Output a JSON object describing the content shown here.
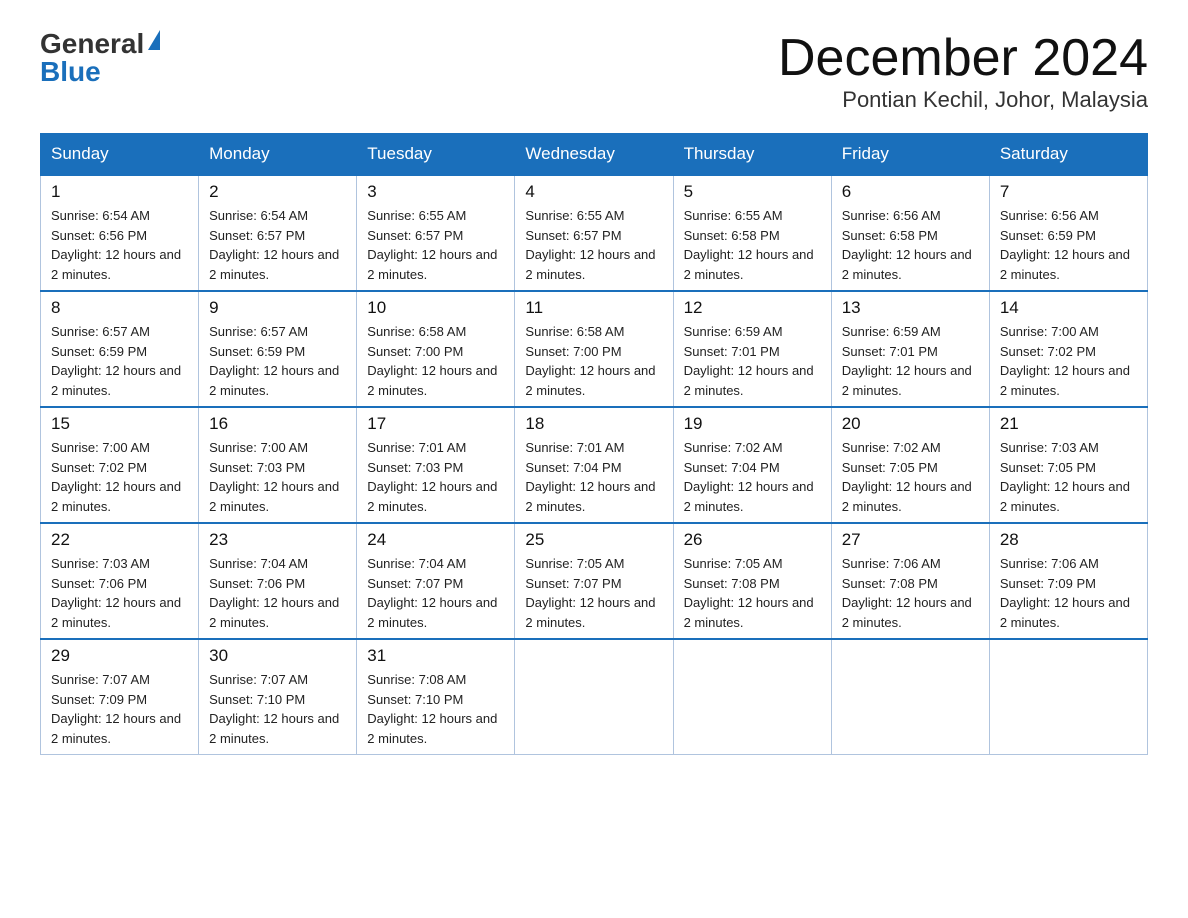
{
  "header": {
    "logo_general": "General",
    "logo_blue": "Blue",
    "title": "December 2024",
    "subtitle": "Pontian Kechil, Johor, Malaysia"
  },
  "weekdays": [
    "Sunday",
    "Monday",
    "Tuesday",
    "Wednesday",
    "Thursday",
    "Friday",
    "Saturday"
  ],
  "weeks": [
    [
      {
        "day": "1",
        "sunrise": "6:54 AM",
        "sunset": "6:56 PM",
        "daylight": "12 hours and 2 minutes."
      },
      {
        "day": "2",
        "sunrise": "6:54 AM",
        "sunset": "6:57 PM",
        "daylight": "12 hours and 2 minutes."
      },
      {
        "day": "3",
        "sunrise": "6:55 AM",
        "sunset": "6:57 PM",
        "daylight": "12 hours and 2 minutes."
      },
      {
        "day": "4",
        "sunrise": "6:55 AM",
        "sunset": "6:57 PM",
        "daylight": "12 hours and 2 minutes."
      },
      {
        "day": "5",
        "sunrise": "6:55 AM",
        "sunset": "6:58 PM",
        "daylight": "12 hours and 2 minutes."
      },
      {
        "day": "6",
        "sunrise": "6:56 AM",
        "sunset": "6:58 PM",
        "daylight": "12 hours and 2 minutes."
      },
      {
        "day": "7",
        "sunrise": "6:56 AM",
        "sunset": "6:59 PM",
        "daylight": "12 hours and 2 minutes."
      }
    ],
    [
      {
        "day": "8",
        "sunrise": "6:57 AM",
        "sunset": "6:59 PM",
        "daylight": "12 hours and 2 minutes."
      },
      {
        "day": "9",
        "sunrise": "6:57 AM",
        "sunset": "6:59 PM",
        "daylight": "12 hours and 2 minutes."
      },
      {
        "day": "10",
        "sunrise": "6:58 AM",
        "sunset": "7:00 PM",
        "daylight": "12 hours and 2 minutes."
      },
      {
        "day": "11",
        "sunrise": "6:58 AM",
        "sunset": "7:00 PM",
        "daylight": "12 hours and 2 minutes."
      },
      {
        "day": "12",
        "sunrise": "6:59 AM",
        "sunset": "7:01 PM",
        "daylight": "12 hours and 2 minutes."
      },
      {
        "day": "13",
        "sunrise": "6:59 AM",
        "sunset": "7:01 PM",
        "daylight": "12 hours and 2 minutes."
      },
      {
        "day": "14",
        "sunrise": "7:00 AM",
        "sunset": "7:02 PM",
        "daylight": "12 hours and 2 minutes."
      }
    ],
    [
      {
        "day": "15",
        "sunrise": "7:00 AM",
        "sunset": "7:02 PM",
        "daylight": "12 hours and 2 minutes."
      },
      {
        "day": "16",
        "sunrise": "7:00 AM",
        "sunset": "7:03 PM",
        "daylight": "12 hours and 2 minutes."
      },
      {
        "day": "17",
        "sunrise": "7:01 AM",
        "sunset": "7:03 PM",
        "daylight": "12 hours and 2 minutes."
      },
      {
        "day": "18",
        "sunrise": "7:01 AM",
        "sunset": "7:04 PM",
        "daylight": "12 hours and 2 minutes."
      },
      {
        "day": "19",
        "sunrise": "7:02 AM",
        "sunset": "7:04 PM",
        "daylight": "12 hours and 2 minutes."
      },
      {
        "day": "20",
        "sunrise": "7:02 AM",
        "sunset": "7:05 PM",
        "daylight": "12 hours and 2 minutes."
      },
      {
        "day": "21",
        "sunrise": "7:03 AM",
        "sunset": "7:05 PM",
        "daylight": "12 hours and 2 minutes."
      }
    ],
    [
      {
        "day": "22",
        "sunrise": "7:03 AM",
        "sunset": "7:06 PM",
        "daylight": "12 hours and 2 minutes."
      },
      {
        "day": "23",
        "sunrise": "7:04 AM",
        "sunset": "7:06 PM",
        "daylight": "12 hours and 2 minutes."
      },
      {
        "day": "24",
        "sunrise": "7:04 AM",
        "sunset": "7:07 PM",
        "daylight": "12 hours and 2 minutes."
      },
      {
        "day": "25",
        "sunrise": "7:05 AM",
        "sunset": "7:07 PM",
        "daylight": "12 hours and 2 minutes."
      },
      {
        "day": "26",
        "sunrise": "7:05 AM",
        "sunset": "7:08 PM",
        "daylight": "12 hours and 2 minutes."
      },
      {
        "day": "27",
        "sunrise": "7:06 AM",
        "sunset": "7:08 PM",
        "daylight": "12 hours and 2 minutes."
      },
      {
        "day": "28",
        "sunrise": "7:06 AM",
        "sunset": "7:09 PM",
        "daylight": "12 hours and 2 minutes."
      }
    ],
    [
      {
        "day": "29",
        "sunrise": "7:07 AM",
        "sunset": "7:09 PM",
        "daylight": "12 hours and 2 minutes."
      },
      {
        "day": "30",
        "sunrise": "7:07 AM",
        "sunset": "7:10 PM",
        "daylight": "12 hours and 2 minutes."
      },
      {
        "day": "31",
        "sunrise": "7:08 AM",
        "sunset": "7:10 PM",
        "daylight": "12 hours and 2 minutes."
      },
      null,
      null,
      null,
      null
    ]
  ]
}
